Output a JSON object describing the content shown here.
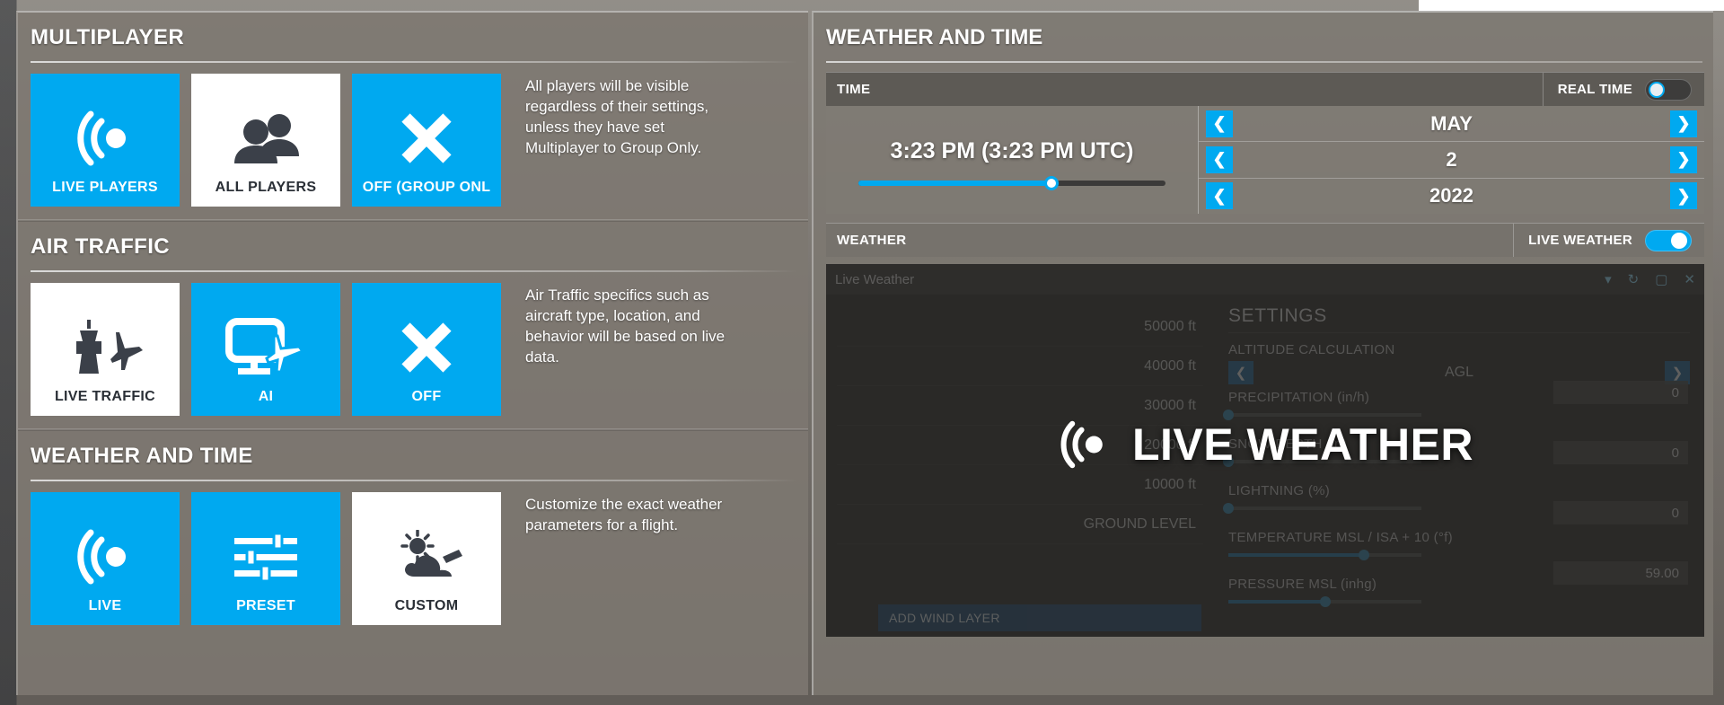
{
  "left_panel": {
    "sections": [
      {
        "title": "MULTIPLAYER",
        "description": "All players will be visible regardless of their settings, unless they have set Multiplayer to Group Only.",
        "options": [
          {
            "label": "LIVE PLAYERS",
            "icon": "live-broadcast-icon",
            "selected": false
          },
          {
            "label": "ALL PLAYERS",
            "icon": "people-icon",
            "selected": true
          },
          {
            "label": "OFF (GROUP ONL",
            "icon": "cross-icon",
            "selected": false
          }
        ]
      },
      {
        "title": "AIR TRAFFIC",
        "description": "Air Traffic specifics such as aircraft type, location, and behavior will be based on live data.",
        "options": [
          {
            "label": "LIVE TRAFFIC",
            "icon": "control-tower-plane-icon",
            "selected": true
          },
          {
            "label": "AI",
            "icon": "monitor-plane-icon",
            "selected": false
          },
          {
            "label": "OFF",
            "icon": "cross-icon",
            "selected": false
          }
        ]
      },
      {
        "title": "WEATHER AND TIME",
        "description": "Customize the exact weather parameters for a flight.",
        "options": [
          {
            "label": "LIVE",
            "icon": "live-broadcast-icon",
            "selected": false
          },
          {
            "label": "PRESET",
            "icon": "sliders-icon",
            "selected": false
          },
          {
            "label": "CUSTOM",
            "icon": "sun-cloud-icon",
            "selected": true
          }
        ]
      }
    ]
  },
  "right_panel": {
    "title": "WEATHER AND TIME",
    "time_bar": {
      "label": "TIME",
      "real_time_label": "REAL TIME",
      "real_time_on": false
    },
    "time": {
      "display": "3:23 PM (3:23 PM UTC)",
      "slider_percent": 63
    },
    "date": {
      "month": "MAY",
      "day": "2",
      "year": "2022",
      "prev_icon": "chevron-left-icon",
      "next_icon": "chevron-right-icon"
    },
    "weather_bar": {
      "label": "WEATHER",
      "live_weather_label": "LIVE WEATHER",
      "live_weather_on": true
    },
    "weather_panel": {
      "preset_name": "Live Weather",
      "banner_text": "LIVE WEATHER",
      "banner_icon": "live-broadcast-icon",
      "altitude_labels": [
        "50000 ft",
        "40000 ft",
        "30000 ft",
        "20000 ft",
        "10000 ft",
        "GROUND LEVEL"
      ],
      "add_wind_layer_label": "ADD WIND LAYER",
      "settings_title": "SETTINGS",
      "settings": [
        {
          "label": "ALTITUDE CALCULATION",
          "type": "stepper",
          "value": "AGL"
        },
        {
          "label": "PRECIPITATION (in/h)",
          "type": "slider-value",
          "value": "0",
          "percent": 0
        },
        {
          "label": "SNOW DEPTH (in)",
          "type": "slider-value",
          "value": "0",
          "percent": 0
        },
        {
          "label": "LIGHTNING (%)",
          "type": "slider-value",
          "value": "0",
          "percent": 0
        },
        {
          "label": "TEMPERATURE MSL / ISA + 10 (°f)",
          "type": "slider-value",
          "value": "59.00",
          "percent": 70
        },
        {
          "label": "PRESSURE MSL (inhg)",
          "type": "slider-value",
          "value": "",
          "percent": 50
        }
      ]
    }
  },
  "colors": {
    "accent": "#00a9f0",
    "panel": "#7d7871",
    "selected_tile": "#ffffff",
    "dark": "#2a2927"
  }
}
